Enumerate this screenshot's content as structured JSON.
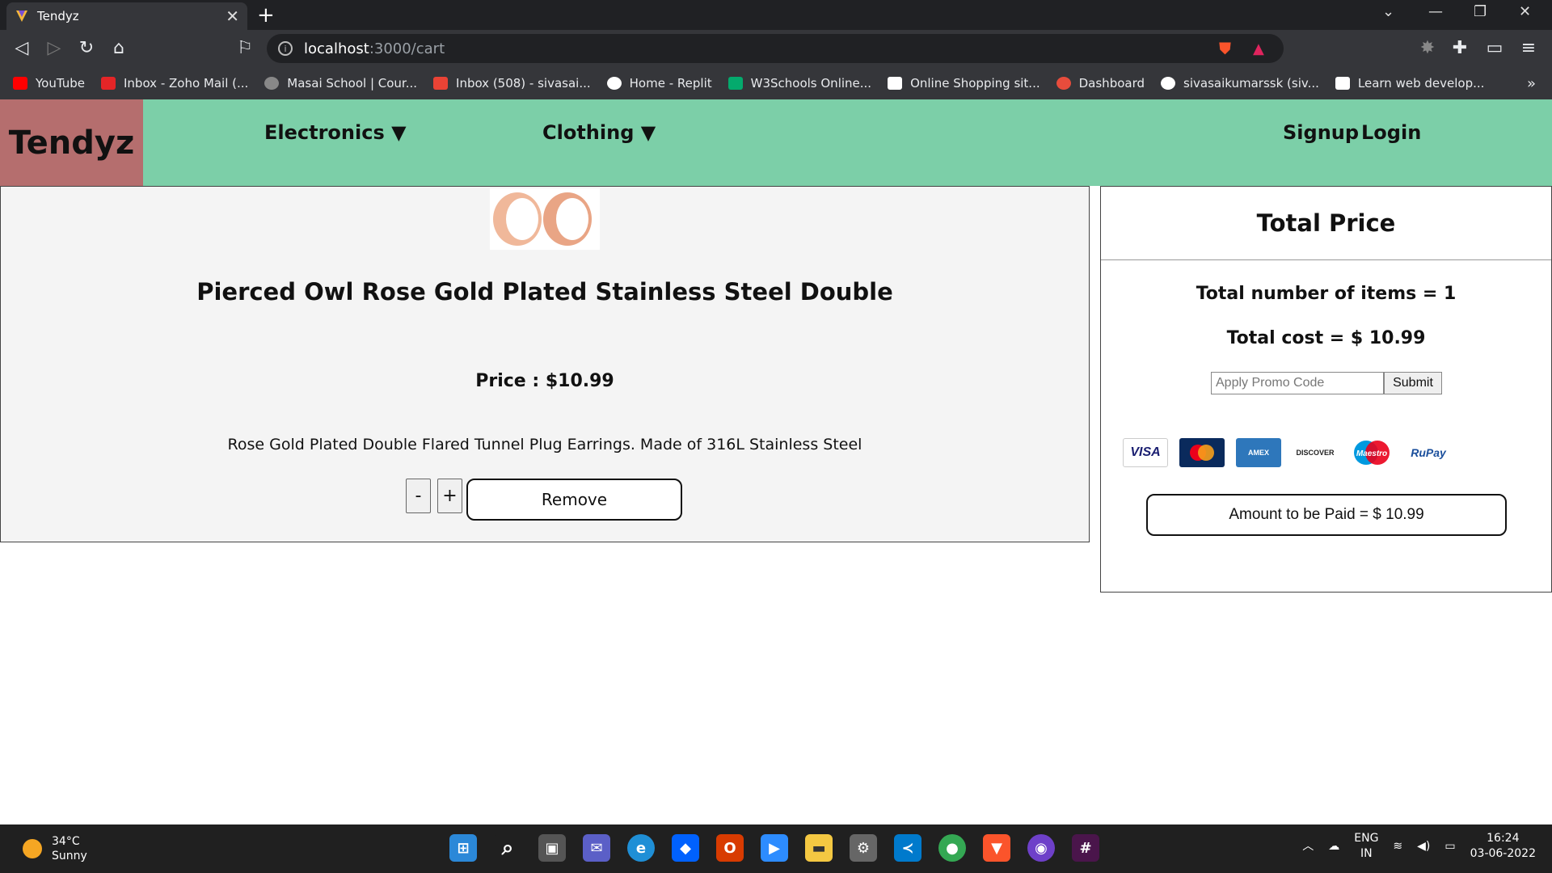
{
  "browser": {
    "tab_title": "Tendyz",
    "url_host": "localhost",
    "url_path": ":3000/cart",
    "bookmarks": [
      {
        "label": "YouTube",
        "icon": "youtube-icon",
        "color": "#ff0000"
      },
      {
        "label": "Inbox - Zoho Mail (...",
        "icon": "zoho-icon",
        "color": "#e42527"
      },
      {
        "label": "Masai School | Cour...",
        "icon": "masai-icon",
        "color": "#888888"
      },
      {
        "label": "Inbox (508) - sivasai...",
        "icon": "gmail-icon",
        "color": "#ea4335"
      },
      {
        "label": "Home - Replit",
        "icon": "replit-icon",
        "color": "#ffffff"
      },
      {
        "label": "W3Schools Online...",
        "icon": "w3schools-icon",
        "color": "#04aa6d"
      },
      {
        "label": "Online Shopping sit...",
        "icon": "amazon-icon",
        "color": "#ffffff"
      },
      {
        "label": "Dashboard",
        "icon": "dashboard-icon",
        "color": "#e74c3c"
      },
      {
        "label": "sivasaikumarssk (siv...",
        "icon": "github-icon",
        "color": "#ffffff"
      },
      {
        "label": "Learn web develop...",
        "icon": "learn-icon",
        "color": "#ffffff"
      }
    ]
  },
  "site": {
    "logo": "Tendyz",
    "menu": {
      "electronics": "Electronics ▼",
      "clothing": "Clothing ▼",
      "signup": "Signup",
      "login": "Login"
    }
  },
  "cart": {
    "item": {
      "title": "Pierced Owl Rose Gold Plated Stainless Steel Double",
      "price": "Price : $10.99",
      "description": "Rose Gold Plated Double Flared Tunnel Plug Earrings. Made of 316L Stainless Steel",
      "minus": "-",
      "plus": "+",
      "remove": "Remove"
    }
  },
  "summary": {
    "title": "Total Price",
    "items": "Total number of items = 1",
    "cost": "Total cost = $ 10.99",
    "promo_placeholder": "Apply Promo Code",
    "submit": "Submit",
    "cards": [
      {
        "label": "VISA",
        "icon": "visa-icon",
        "bg": "#ffffff",
        "fg": "#1a1f71"
      },
      {
        "label": "MC",
        "icon": "mastercard-icon",
        "bg": "#0a2a5c",
        "fg": "#f79e1b"
      },
      {
        "label": "AMEX",
        "icon": "amex-icon",
        "bg": "#2e77bb",
        "fg": "#ffffff"
      },
      {
        "label": "DISCOVER",
        "icon": "discover-icon",
        "bg": "#ffffff",
        "fg": "#222222"
      },
      {
        "label": "Maestro",
        "icon": "maestro-icon",
        "bg": "#ffffff",
        "fg": "#ffffff"
      },
      {
        "label": "RuPay",
        "icon": "rupay-icon",
        "bg": "#ffffff",
        "fg": "#1b4f9c"
      }
    ],
    "amount": "Amount to be Paid = $ 10.99"
  },
  "taskbar": {
    "temp": "34°C",
    "condition": "Sunny",
    "lang": "ENG",
    "region": "IN",
    "time": "16:24",
    "date": "03-06-2022",
    "apps": [
      {
        "icon": "windows-start-icon",
        "color": "#2b88d8",
        "glyph": "⊞"
      },
      {
        "icon": "search-icon",
        "color": "#202020",
        "glyph": "⌕"
      },
      {
        "icon": "task-view-icon",
        "color": "#444444",
        "glyph": "▣"
      },
      {
        "icon": "teams-chat-icon",
        "color": "#5b5fc7",
        "glyph": "✉"
      },
      {
        "icon": "edge-icon",
        "color": "#1f8fd6",
        "glyph": "e"
      },
      {
        "icon": "dropbox-icon",
        "color": "#0061fe",
        "glyph": "◆"
      },
      {
        "icon": "office-icon",
        "color": "#d83b01",
        "glyph": "O"
      },
      {
        "icon": "zoom-icon",
        "color": "#2d8cff",
        "glyph": "▶"
      },
      {
        "icon": "file-explorer-icon",
        "color": "#f4c842",
        "glyph": "▬"
      },
      {
        "icon": "settings-icon",
        "color": "#666666",
        "glyph": "⚙"
      },
      {
        "icon": "vscode-icon",
        "color": "#007acc",
        "glyph": "≺"
      },
      {
        "icon": "chrome-icon",
        "color": "#34a853",
        "glyph": "●"
      },
      {
        "icon": "brave-icon",
        "color": "#fb542b",
        "glyph": "▼"
      },
      {
        "icon": "github-desktop-icon",
        "color": "#6e40c9",
        "glyph": "◉"
      },
      {
        "icon": "slack-icon",
        "color": "#4a154b",
        "glyph": "#"
      }
    ]
  }
}
